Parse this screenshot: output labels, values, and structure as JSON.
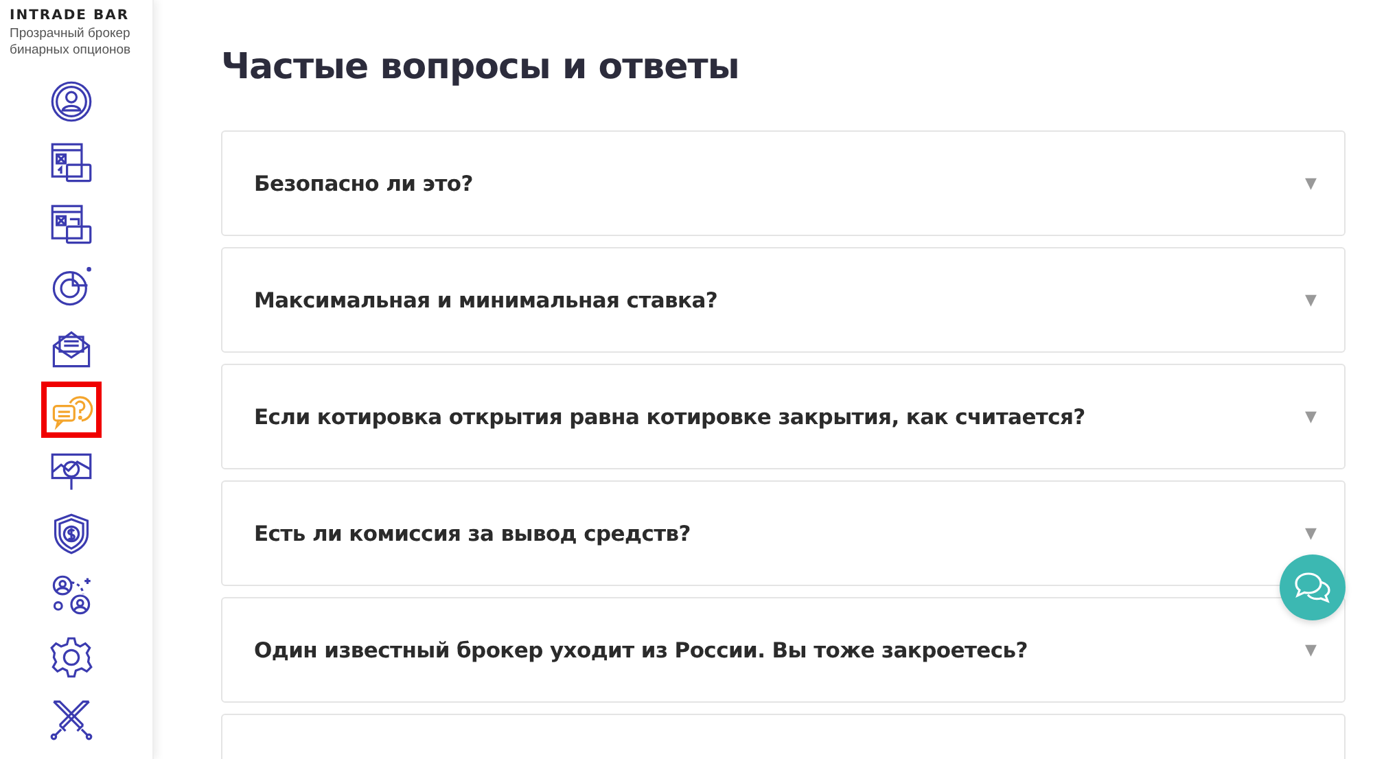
{
  "logo": {
    "text": "INTRADE BAR",
    "tagline": "Прозрачный брокер бинарных опционов"
  },
  "nav": [
    {
      "kind": "profile",
      "selected": false
    },
    {
      "kind": "deposit",
      "selected": false
    },
    {
      "kind": "withdraw",
      "selected": false
    },
    {
      "kind": "chart",
      "selected": false
    },
    {
      "kind": "mail",
      "selected": false
    },
    {
      "kind": "faq",
      "selected": true
    },
    {
      "kind": "analytics",
      "selected": false
    },
    {
      "kind": "security",
      "selected": false
    },
    {
      "kind": "referral",
      "selected": false
    },
    {
      "kind": "settings",
      "selected": false
    },
    {
      "kind": "tournament",
      "selected": false
    }
  ],
  "page_title": "Частые вопросы и ответы",
  "questions": [
    {
      "text": "Безопасно ли это?",
      "arrow": "▼",
      "expanded": false
    },
    {
      "text": "Максимальная и минимальная ставка?",
      "arrow": "▼",
      "expanded": false
    },
    {
      "text": "Если котировка открытия равна котировке закрытия, как считается?",
      "arrow": "▼",
      "expanded": false
    },
    {
      "text": "Есть ли комиссия за вывод средств?",
      "arrow": "▼",
      "expanded": false
    },
    {
      "text": "Один известный брокер уходит из России. Вы тоже закроетесь?",
      "arrow": "▼",
      "expanded": false
    }
  ]
}
